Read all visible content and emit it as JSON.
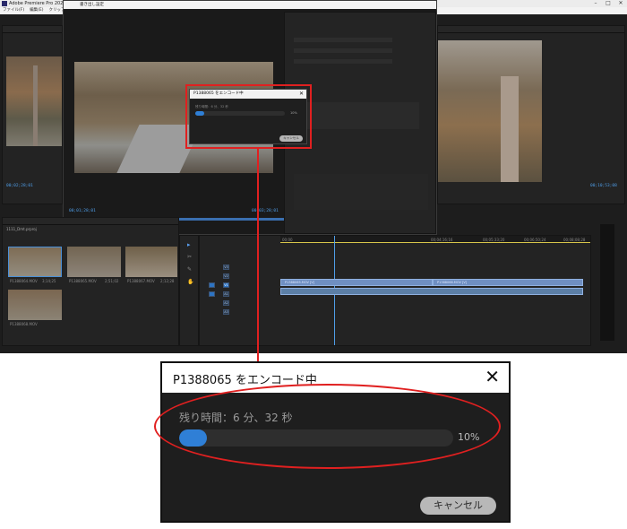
{
  "app": {
    "title": "Adobe Premiere Pro 2020 - C:\\",
    "menu": [
      "ファイル(F)",
      "編集(E)",
      "クリップ(C)"
    ],
    "export_window_title": "書き出し設定"
  },
  "timecodes": {
    "source": "00;02;28;01",
    "program": "00;10;53;08",
    "export_in": "00;01;28;01",
    "export_out": "00;03;28;01",
    "ruler": [
      "00;00",
      "00;04;16;16",
      "00;05;33;20",
      "00;06;50;24",
      "00;08;08;28"
    ]
  },
  "project": {
    "name": "1111_Dmt.prproj",
    "items": [
      {
        "name": "P1388064.MOV",
        "dur": "3;14;25"
      },
      {
        "name": "P1388065.MOV",
        "dur": "2;51;02"
      },
      {
        "name": "P1388067.MOV",
        "dur": "2;12;28"
      },
      {
        "name": "P1388068.MOV",
        "dur": ""
      }
    ]
  },
  "timeline": {
    "clips": [
      "P1388065.MOV [V]",
      "P1388066.MOV [V]"
    ],
    "tracks": [
      "V1",
      "V2",
      "V3",
      "A1",
      "A2",
      "A3"
    ]
  },
  "mini_dialog": {
    "title": "P1388065 をエンコード中",
    "remaining": "残り時間：6 分、32 秒",
    "percent_label": "10%",
    "cancel": "キャンセル"
  },
  "encode_dialog": {
    "title": "P1388065 をエンコード中",
    "close_glyph": "✕",
    "remaining": "残り時間：6 分、32 秒",
    "progress": 0.1,
    "percent_label": "10%",
    "cancel": "キャンセル"
  },
  "colors": {
    "accent": "#2f7fd6",
    "highlight": "#e02020"
  }
}
